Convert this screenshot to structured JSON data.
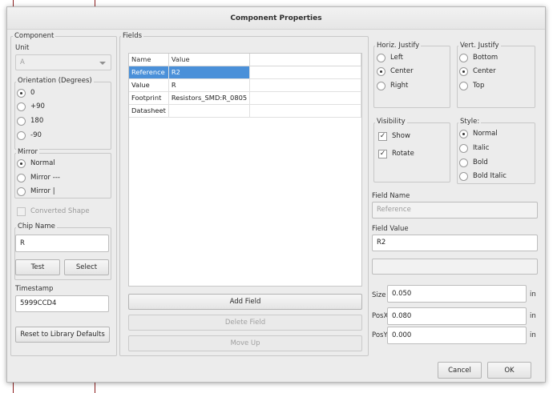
{
  "window": {
    "title": "Component Properties"
  },
  "component": {
    "group_title": "Component",
    "unit_label": "Unit",
    "unit_value": "A",
    "orientation_title": "Orientation (Degrees)",
    "orientation_options": [
      "0",
      "+90",
      "180",
      "-90"
    ],
    "mirror_title": "Mirror",
    "mirror_options": [
      "Normal",
      "Mirror ---",
      "Mirror |"
    ],
    "converted_shape": "Converted Shape",
    "chip_name_title": "Chip Name",
    "chip_name_value": "R",
    "test_label": "Test",
    "select_label": "Select",
    "timestamp_label": "Timestamp",
    "timestamp_value": "5999CCD4",
    "reset_label": "Reset to Library Defaults"
  },
  "fields": {
    "group_title": "Fields",
    "columns": [
      "Name",
      "Value"
    ],
    "rows": [
      {
        "name": "Reference",
        "value": "R2",
        "selected": true
      },
      {
        "name": "Value",
        "value": "R",
        "selected": false
      },
      {
        "name": "Footprint",
        "value": "Resistors_SMD:R_0805",
        "selected": false
      },
      {
        "name": "Datasheet",
        "value": "",
        "selected": false
      }
    ],
    "add_label": "Add Field",
    "delete_label": "Delete Field",
    "move_up_label": "Move Up"
  },
  "properties": {
    "horiz_title": "Horiz. Justify",
    "horiz_options": [
      "Left",
      "Center",
      "Right"
    ],
    "vert_title": "Vert. Justify",
    "vert_options": [
      "Bottom",
      "Center",
      "Top"
    ],
    "visibility_title": "Visibility",
    "show_label": "Show",
    "rotate_label": "Rotate",
    "style_title": "Style:",
    "style_options": [
      "Normal",
      "Italic",
      "Bold",
      "Bold Italic"
    ],
    "field_name_label": "Field Name",
    "field_name_value": "Reference",
    "field_value_label": "Field Value",
    "field_value_value": "R2",
    "size_label": "Size",
    "size_value": "0.050",
    "posx_label": "PosX",
    "posx_value": "0.080",
    "posy_label": "PosY",
    "posy_value": "0.000",
    "unit": "in"
  },
  "footer": {
    "cancel_label": "Cancel",
    "ok_label": "OK"
  }
}
